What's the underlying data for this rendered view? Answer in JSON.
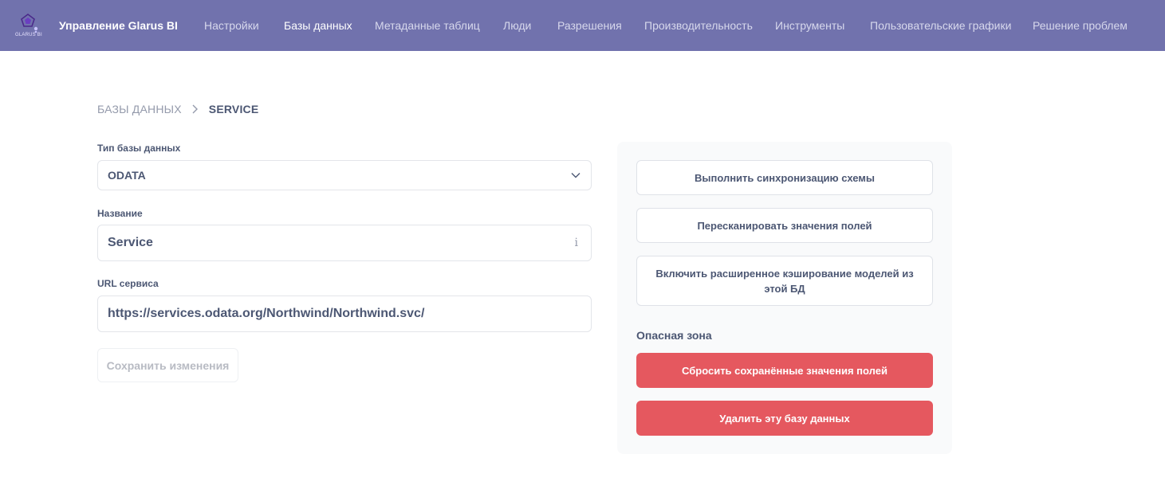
{
  "app": {
    "brand": "Управление Glarus BI",
    "logo_text": "GLARUS BI"
  },
  "nav": {
    "items": [
      {
        "label": "Настройки",
        "active": false
      },
      {
        "label": "Базы данных",
        "active": true
      },
      {
        "label": "Метаданные таблиц",
        "active": false
      },
      {
        "label": "Люди",
        "active": false
      },
      {
        "label": "Разрешения",
        "active": false
      },
      {
        "label": "Производительность",
        "active": false
      },
      {
        "label": "Инструменты",
        "active": false
      },
      {
        "label": "Пользовательские графики",
        "active": false
      },
      {
        "label": "Решение проблем",
        "active": false
      }
    ]
  },
  "breadcrumb": {
    "parent": "БАЗЫ ДАННЫХ",
    "current": "SERVICE",
    "separator_icon": "chevron-right-icon"
  },
  "form": {
    "db_type": {
      "label": "Тип базы данных",
      "value": "ODATA",
      "icon": "chevron-down-icon"
    },
    "name": {
      "label": "Название",
      "value": "Service",
      "icon": "info-icon",
      "icon_glyph": "i"
    },
    "url": {
      "label": "URL сервиса",
      "value": "https://services.odata.org/Northwind/Northwind.svc/"
    },
    "save_label": "Сохранить изменения"
  },
  "side": {
    "sync_label": "Выполнить синхронизацию схемы",
    "rescan_label": "Пересканировать значения полей",
    "caching_label": "Включить расширенное кэширование моделей из этой БД",
    "danger_zone_title": "Опасная зона",
    "reset_label": "Сбросить сохранённые значения полей",
    "delete_label": "Удалить эту базу данных"
  },
  "colors": {
    "header_bg": "#7172ad",
    "danger": "#e5585f",
    "panel_bg": "#f9fafb",
    "text": "#4c5773"
  }
}
